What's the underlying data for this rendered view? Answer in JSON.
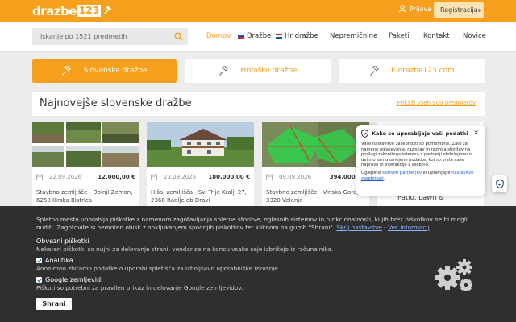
{
  "header": {
    "logo_text": "drazbe",
    "logo_box": "123",
    "login_label": "Prijava",
    "register_label": "Registracija"
  },
  "search": {
    "placeholder": "Iskanje po 1521 predmetih"
  },
  "nav": {
    "items": [
      {
        "label": "Domov",
        "active": true
      },
      {
        "label": "Dražbe",
        "flag": "si"
      },
      {
        "label": "Hr dražbe",
        "flag": "hr"
      },
      {
        "label": "Nepremičnine"
      },
      {
        "label": "Paketi"
      },
      {
        "label": "Kontakt"
      },
      {
        "label": "Novice"
      }
    ]
  },
  "tabs": [
    {
      "label": "Slovenske dražbe"
    },
    {
      "label": "Hrvaške dražbe"
    },
    {
      "label": "E.drazbe123.com"
    }
  ],
  "latest": {
    "title": "Najnovejše slovenske dražbe",
    "link": "Prikaži vseh 909 predmetov"
  },
  "cards": [
    {
      "date": "22.09.2026",
      "price": "12.000,00 €",
      "title": "Stavbno zemljišče - Dolnji Zemon, 6250 Ilirska Bistrica"
    },
    {
      "date": "23.09.2026",
      "price": "180.000,00 €",
      "title": "Hiša, zemljišča - Sv. Trije Kralji 27, 2360 Radlje ob Dravi"
    },
    {
      "date": "09.09.2026",
      "price": "394.000,00",
      "title": "Stavbno zemljišče - Vinska Gora, 3320 Velenje"
    },
    {
      "title": "Patio, Lawn &"
    }
  ],
  "privacy": {
    "title": "Kako se uporabljajo vaši podatki",
    "close": "×",
    "body": "Vaše nastavitve zasebnosti so pomembne. Zato za namene oglaševanja, raziskav in razvoja storitev na podlagi zakonitega interesa s partnerji obdelujemo in delimo samo omejene podatke, kot so vrsta vaše naprave in interakcije z vsebino.",
    "body2_prefix": "Oglejte si ",
    "body2_link1": "seznam partnerjev",
    "body2_mid": " in upravljajte ",
    "body2_link2": "nastavitve zasebnosti",
    "body2_suffix": "."
  },
  "cookie": {
    "text": "Spletno mesto uporablja piškotke z namenom zagotavljanja spletne storitve, oglasnih sistemov in funkcionalnosti, ki jih brez piškotkov ne bi mogli nuditi. Zagotovite si nemoten obisk z obkljukanjem spodnjih piškotkov ter kliknom na gumb \"Shrani\".",
    "link_settings": "Skrij nastavitve",
    "link_sep": " - ",
    "link_more": "Več informacij",
    "required_title": "Obvezni piškotki",
    "required_desc": "Nekateri piškotki so nujni za delovanje strani, vendar se na koncu vsake seje izbrišejo iz računalnika.",
    "analytics_label": "Analitika",
    "analytics_desc": "Anonimno zbiramo podatke o uporabi spletišča za izboljšavo uporabniške izkušnje.",
    "maps_label": "Google zemljevidi",
    "maps_desc": "Piškoti so potrebni za pravilen prikaz in delovanje Google zemljevidov.",
    "save_label": "Shrani"
  },
  "colors": {
    "accent": "#f7a01e",
    "banner": "#2f2f2f"
  }
}
